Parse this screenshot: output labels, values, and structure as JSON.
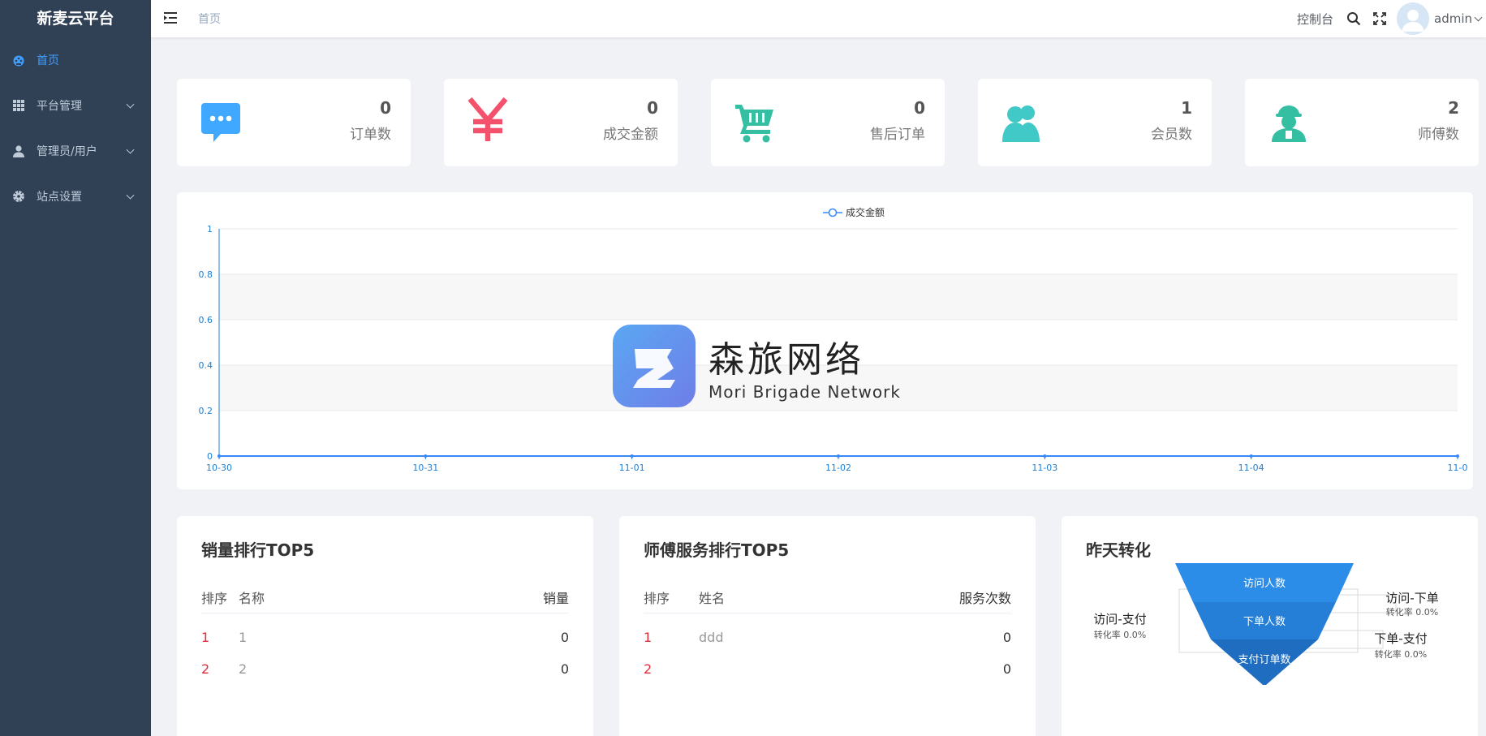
{
  "app_title": "新麦云平台",
  "sidebar": {
    "items": [
      {
        "label": "首页",
        "icon": "dashboard-icon",
        "active": true
      },
      {
        "label": "平台管理",
        "icon": "grid-icon",
        "expandable": true
      },
      {
        "label": "管理员/用户",
        "icon": "user-icon",
        "expandable": true
      },
      {
        "label": "站点设置",
        "icon": "gear-icon",
        "expandable": true
      }
    ]
  },
  "header": {
    "breadcrumb": "首页",
    "console_label": "控制台",
    "username": "admin"
  },
  "stats": [
    {
      "value": "0",
      "label": "订单数",
      "icon": "chat-bubble-icon",
      "color": "#40a9ff"
    },
    {
      "value": "0",
      "label": "成交金额",
      "icon": "yen-icon",
      "color": "#f4516c"
    },
    {
      "value": "0",
      "label": "售后订单",
      "icon": "cart-icon",
      "color": "#34bfa3"
    },
    {
      "value": "1",
      "label": "会员数",
      "icon": "users-icon",
      "color": "#40c9c6"
    },
    {
      "value": "2",
      "label": "师傅数",
      "icon": "worker-icon",
      "color": "#34bfa3"
    }
  ],
  "chart_data": {
    "type": "line",
    "series": [
      {
        "name": "成交金额",
        "values": [
          0,
          0,
          0,
          0,
          0,
          0,
          0
        ]
      }
    ],
    "categories": [
      "10-30",
      "10-31",
      "11-01",
      "11-02",
      "11-03",
      "11-04",
      "11-0"
    ],
    "yticks": [
      "0",
      "0.2",
      "0.4",
      "0.6",
      "0.8",
      "1"
    ],
    "ylim": [
      0,
      1
    ],
    "legend": "top-center",
    "color": "#3888fa"
  },
  "watermark": {
    "cn": "森旅网络",
    "en": "Mori Brigade Network"
  },
  "sales_rank": {
    "title": "销量排行TOP5",
    "headers": [
      "排序",
      "名称",
      "销量"
    ],
    "rows": [
      {
        "rank": "1",
        "name": "1",
        "value": "0"
      },
      {
        "rank": "2",
        "name": "2",
        "value": "0"
      }
    ]
  },
  "master_rank": {
    "title": "师傅服务排行TOP5",
    "headers": [
      "排序",
      "姓名",
      "服务次数"
    ],
    "rows": [
      {
        "rank": "1",
        "name": "ddd",
        "value": "0"
      },
      {
        "rank": "2",
        "name": "",
        "value": "0"
      }
    ]
  },
  "conversion": {
    "title": "昨天转化",
    "funnel": [
      "访问人数",
      "下单人数",
      "支付订单数"
    ],
    "left": {
      "label": "访问-支付",
      "rate": "转化率 0.0%"
    },
    "right_top": {
      "label": "访问-下单",
      "rate": "转化率 0.0%"
    },
    "right_bottom": {
      "label": "下单-支付",
      "rate": "转化率 0.0%"
    }
  }
}
